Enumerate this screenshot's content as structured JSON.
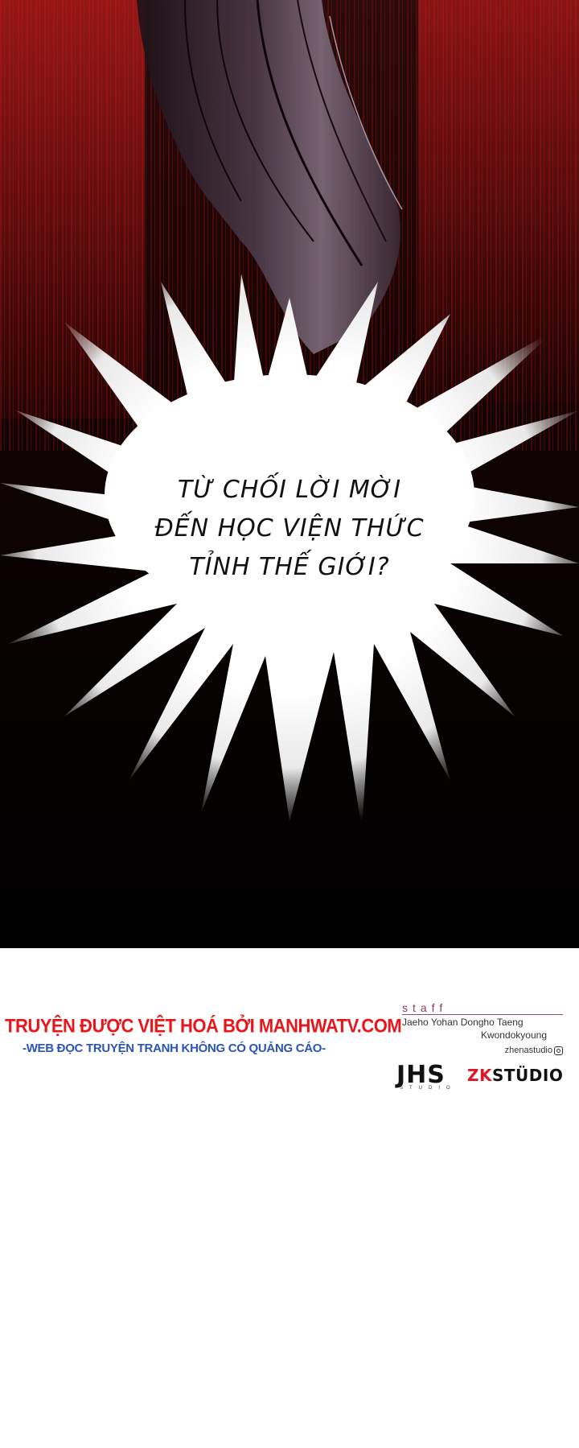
{
  "panel": {
    "burst_text": [
      "TỪ CHỐI LỜI MỜI",
      "ĐẾN HỌC VIỆN THỨC",
      "TỈNH THẾ GIỚI?"
    ]
  },
  "credits": {
    "title": "TRUYỆN ĐƯỢC VIỆT HOÁ BỞI MANHWATV.COM",
    "subtitle": "-WEB ĐỌC TRUYỆN TRANH KHÔNG CÓ QUẢNG CÁO-",
    "title_color": "#e8161b",
    "subtitle_color": "#2a54b8"
  },
  "staff": {
    "label": "staff",
    "names_line1": "Jaeho Yohan Dongho Taeng",
    "names_line2": "Kwondokyoung",
    "studio_handle": "zhenastudio",
    "logo_jhs": "JHS",
    "logo_jhs_sub": "STUDIO",
    "logo_zk": "ZK",
    "logo_studio": "STÜDIO",
    "icons": [
      "instagram-icon"
    ]
  }
}
